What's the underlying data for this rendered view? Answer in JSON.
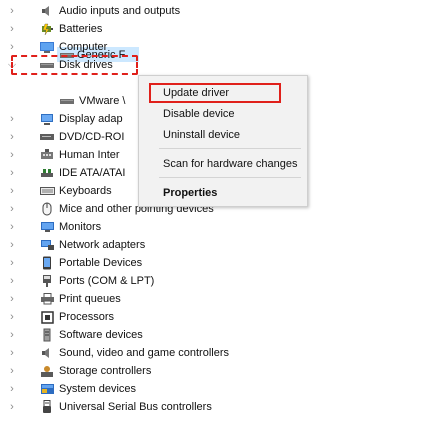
{
  "tree": {
    "items": [
      {
        "label": "Audio inputs and outputs",
        "icon": "speaker-icon"
      },
      {
        "label": "Batteries",
        "icon": "battery-icon"
      },
      {
        "label": "Computer",
        "icon": "computer-icon"
      },
      {
        "label": "Disk drives",
        "icon": "disk-drive-icon"
      },
      {
        "label": "Generic F",
        "icon": "disk-drive-icon"
      },
      {
        "label": "VMware \\",
        "icon": "disk-drive-icon"
      },
      {
        "label": "Display adap",
        "icon": "display-adapter-icon"
      },
      {
        "label": "DVD/CD-ROI",
        "icon": "dvd-drive-icon"
      },
      {
        "label": "Human Inter",
        "icon": "human-interface-icon"
      },
      {
        "label": "IDE ATA/ATAI",
        "icon": "ide-controller-icon"
      },
      {
        "label": "Keyboards",
        "icon": "keyboard-icon"
      },
      {
        "label": "Mice and other pointing devices",
        "icon": "mouse-icon"
      },
      {
        "label": "Monitors",
        "icon": "monitor-icon"
      },
      {
        "label": "Network adapters",
        "icon": "network-adapter-icon"
      },
      {
        "label": "Portable Devices",
        "icon": "portable-device-icon"
      },
      {
        "label": "Ports (COM & LPT)",
        "icon": "port-icon"
      },
      {
        "label": "Print queues",
        "icon": "printer-icon"
      },
      {
        "label": "Processors",
        "icon": "processor-icon"
      },
      {
        "label": "Software devices",
        "icon": "software-device-icon"
      },
      {
        "label": "Sound, video and game controllers",
        "icon": "speaker-icon"
      },
      {
        "label": "Storage controllers",
        "icon": "storage-controller-icon"
      },
      {
        "label": "System devices",
        "icon": "system-device-icon"
      },
      {
        "label": "Universal Serial Bus controllers",
        "icon": "usb-icon"
      }
    ]
  },
  "context_menu": {
    "update_driver": "Update driver",
    "disable_device": "Disable device",
    "uninstall_device": "Uninstall device",
    "scan_hardware": "Scan for hardware changes",
    "properties": "Properties"
  },
  "colors": {
    "highlight_red": "#e0201b",
    "selection_blue": "#cce8ff",
    "menu_bg": "#f2f2f2"
  }
}
